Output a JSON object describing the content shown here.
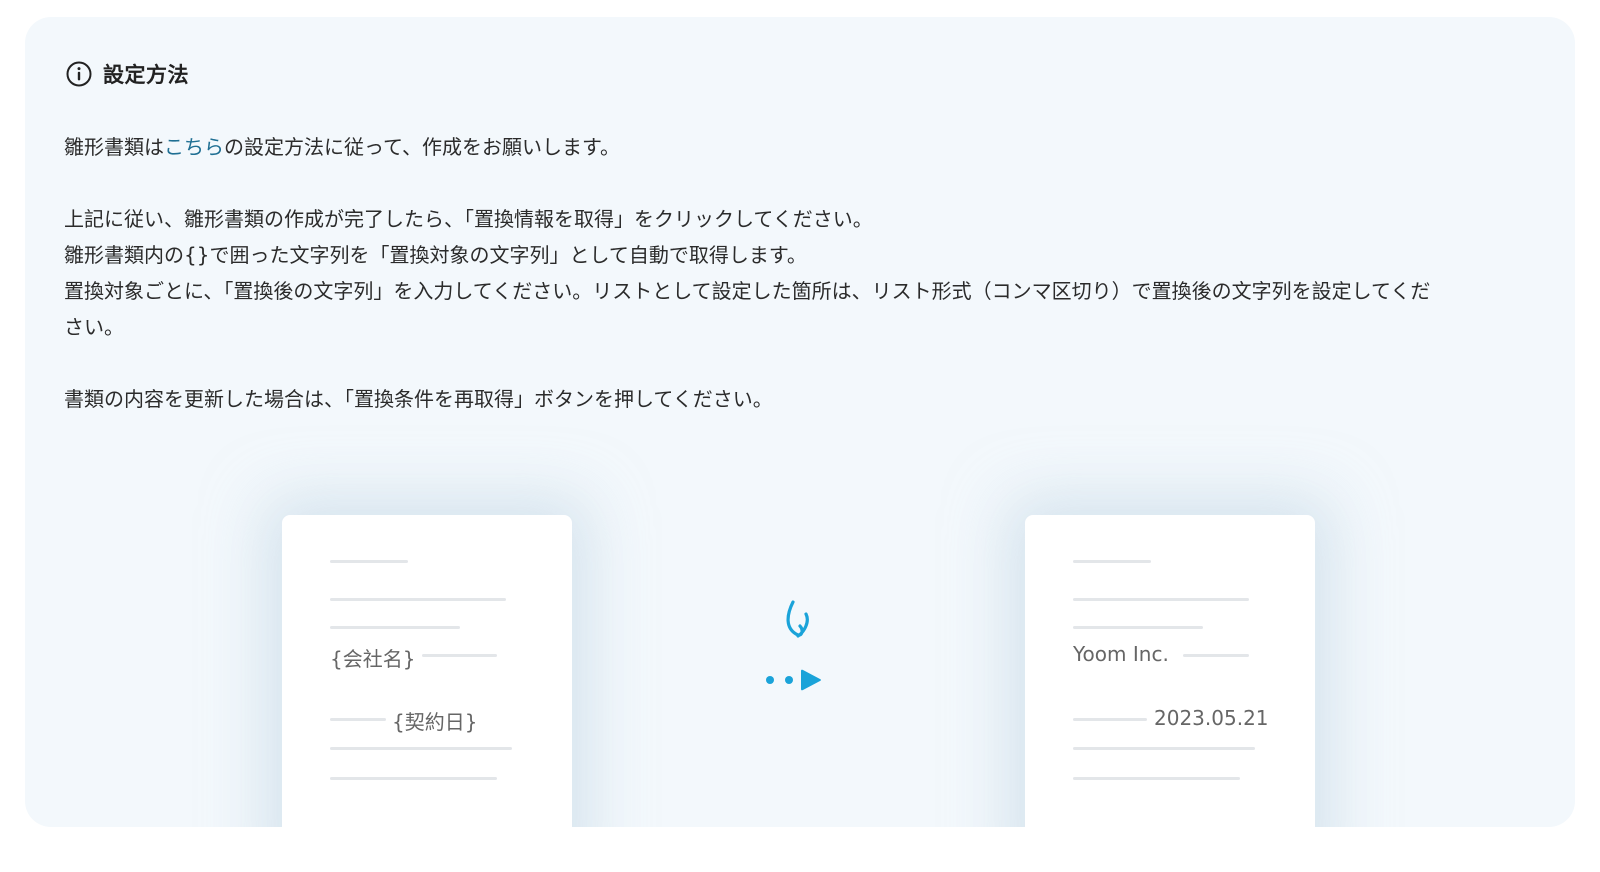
{
  "header": {
    "icon": "info-icon",
    "title": "設定方法"
  },
  "content": {
    "p1_before": "雛形書類は",
    "p1_link": "こちら",
    "p1_after": "の設定方法に従って、作成をお願いします。",
    "p2_line1": "上記に従い、雛形書類の作成が完了したら、「置換情報を取得」をクリックしてください。",
    "p2_line2": "雛形書類内の{}で囲った文字列を「置換対象の文字列」として自動で取得します。",
    "p2_line3": "置換対象ごとに、「置換後の文字列」を入力してください。リストとして設定した箇所は、リスト形式（コンマ区切り）で置換後の文字列を設定してくだ",
    "p2_line4": "さい。",
    "p3": "書類の内容を更新した場合は、「置換条件を再取得」ボタンを押してください。"
  },
  "illustration": {
    "template_doc": {
      "placeholder_company": "{会社名}",
      "placeholder_date": "{契約日}"
    },
    "result_doc": {
      "company": "Yoom Inc.",
      "date": "2023.05.21"
    },
    "colors": {
      "accent": "#1aa3d9",
      "line": "#e3e6e9",
      "panel": "#f3f8fc"
    }
  }
}
